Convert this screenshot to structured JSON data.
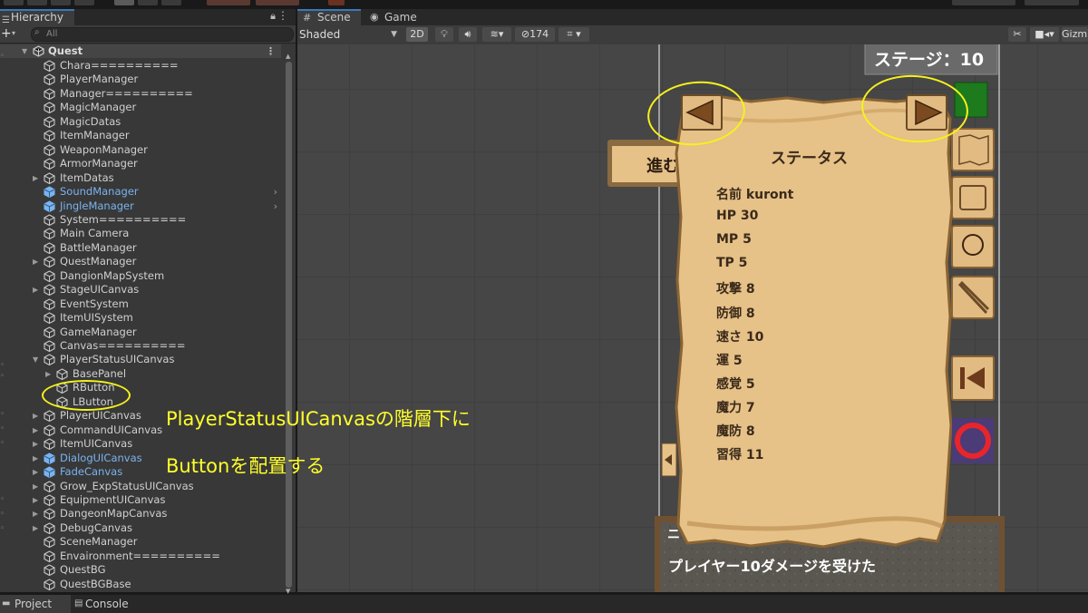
{
  "hierarchy": {
    "tab_label": "Hierarchy",
    "search_placeholder": "All",
    "scene_name": "Quest",
    "items": [
      {
        "label": "Chara=========="
      },
      {
        "label": "PlayerManager"
      },
      {
        "label": "Manager=========="
      },
      {
        "label": "MagicManager"
      },
      {
        "label": "MagicDatas"
      },
      {
        "label": "ItemManager"
      },
      {
        "label": "WeaponManager"
      },
      {
        "label": "ArmorManager"
      },
      {
        "label": "ItemDatas"
      },
      {
        "label": "SoundManager"
      },
      {
        "label": "JingleManager"
      },
      {
        "label": "System=========="
      },
      {
        "label": "Main Camera"
      },
      {
        "label": "BattleManager"
      },
      {
        "label": "QuestManager"
      },
      {
        "label": "DangionMapSystem"
      },
      {
        "label": "StageUICanvas"
      },
      {
        "label": "EventSystem"
      },
      {
        "label": "ItemUISystem"
      },
      {
        "label": "GameManager"
      },
      {
        "label": "Canvas=========="
      },
      {
        "label": "PlayerStatusUICanvas"
      },
      {
        "label": "BasePanel"
      },
      {
        "label": "RButton"
      },
      {
        "label": "LButton"
      },
      {
        "label": "PlayerUICanvas"
      },
      {
        "label": "CommandUICanvas"
      },
      {
        "label": "ItemUICanvas"
      },
      {
        "label": "DialogUICanvas"
      },
      {
        "label": "FadeCanvas"
      },
      {
        "label": "Grow_ExpStatusUICanvas"
      },
      {
        "label": "EquipmentUICanvas"
      },
      {
        "label": "DangeonMapCanvas"
      },
      {
        "label": "DebugCanvas"
      },
      {
        "label": "SceneManager"
      },
      {
        "label": "Envaironment=========="
      },
      {
        "label": "QuestBG"
      },
      {
        "label": "QuestBGBase"
      }
    ]
  },
  "scene": {
    "tabs": [
      {
        "label": "Scene"
      },
      {
        "label": "Game"
      }
    ],
    "toolbar": {
      "shading": "Shaded",
      "mode_2d": "2D",
      "hidden_count": "174",
      "gizmos": "Gizm"
    }
  },
  "game_ui": {
    "stage_label": "ステージ：10",
    "advance_partial": "進む",
    "status_title": "ステータス",
    "stats": [
      {
        "text": "名前 kuront"
      },
      {
        "text": "HP 30"
      },
      {
        "text": "MP 5"
      },
      {
        "text": "TP 5"
      },
      {
        "text": "攻撃 8"
      },
      {
        "text": "防御 8"
      },
      {
        "text": "速さ 10"
      },
      {
        "text": "運 5"
      },
      {
        "text": "感覚 5"
      },
      {
        "text": "魔力 7"
      },
      {
        "text": "魔防 8"
      },
      {
        "text": "習得 11"
      }
    ],
    "message": "プレイヤー10ダメージを受けた",
    "message_partial": "ニ"
  },
  "annotations": {
    "line1": "PlayerStatusUICanvasの階層下に",
    "line2": "Buttonを配置する"
  },
  "bottom_tabs": [
    {
      "label": "Project"
    },
    {
      "label": "Console"
    }
  ],
  "colors": {
    "annotation": "#ffff2b",
    "parchment": "#e6c188",
    "selection_blue": "#7ab3ef"
  }
}
